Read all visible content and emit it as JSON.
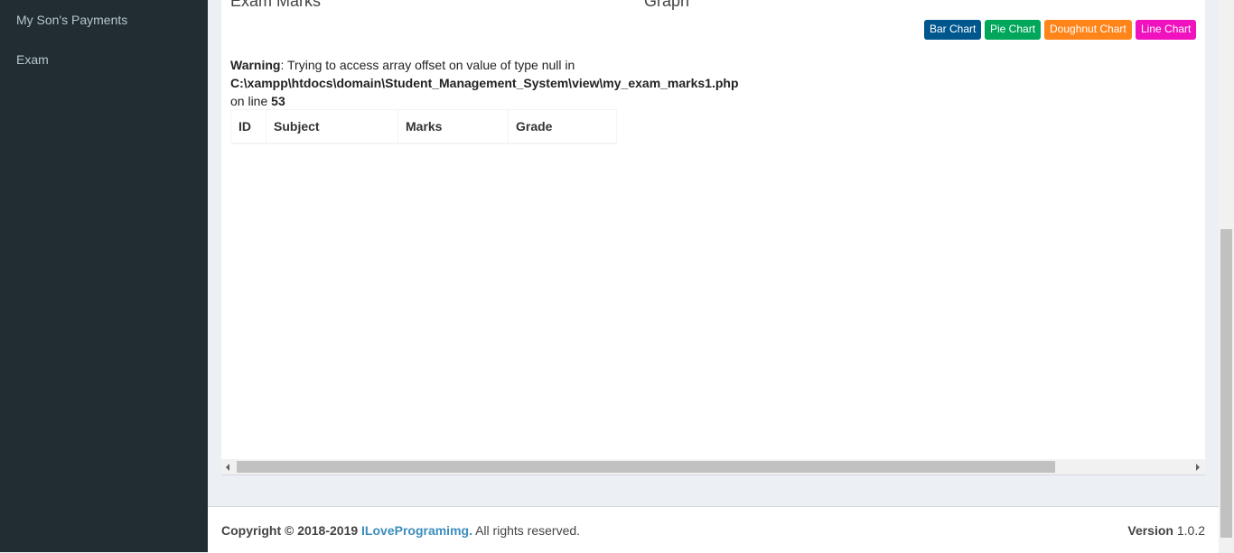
{
  "sidebar": {
    "items": [
      {
        "label": "My Son's Payments"
      },
      {
        "label": "Exam"
      }
    ]
  },
  "main": {
    "left_title": "Exam Marks",
    "right_title": "Graph",
    "chart_buttons": [
      {
        "label": "Bar Chart",
        "color": "#00578e"
      },
      {
        "label": "Pie Chart",
        "color": "#00a65a"
      },
      {
        "label": "Doughnut Chart",
        "color": "#ff851b"
      },
      {
        "label": "Line Chart",
        "color": "#f012be"
      }
    ],
    "warning": {
      "label": "Warning",
      "message": ": Trying to access array offset on value of type null in",
      "path": "C:\\xampp\\htdocs\\domain\\Student_Management_System\\view\\my_exam_marks1.php",
      "line_prefix": "on line",
      "line_number": "53"
    },
    "table": {
      "headers": [
        "ID",
        "Subject",
        "Marks",
        "Grade"
      ]
    }
  },
  "footer": {
    "copyright_prefix": "Copyright © 2018-2019",
    "brand": "ILoveProgramimg.",
    "rights": "All rights reserved.",
    "version_label": "Version",
    "version_value": "1.0.2"
  }
}
